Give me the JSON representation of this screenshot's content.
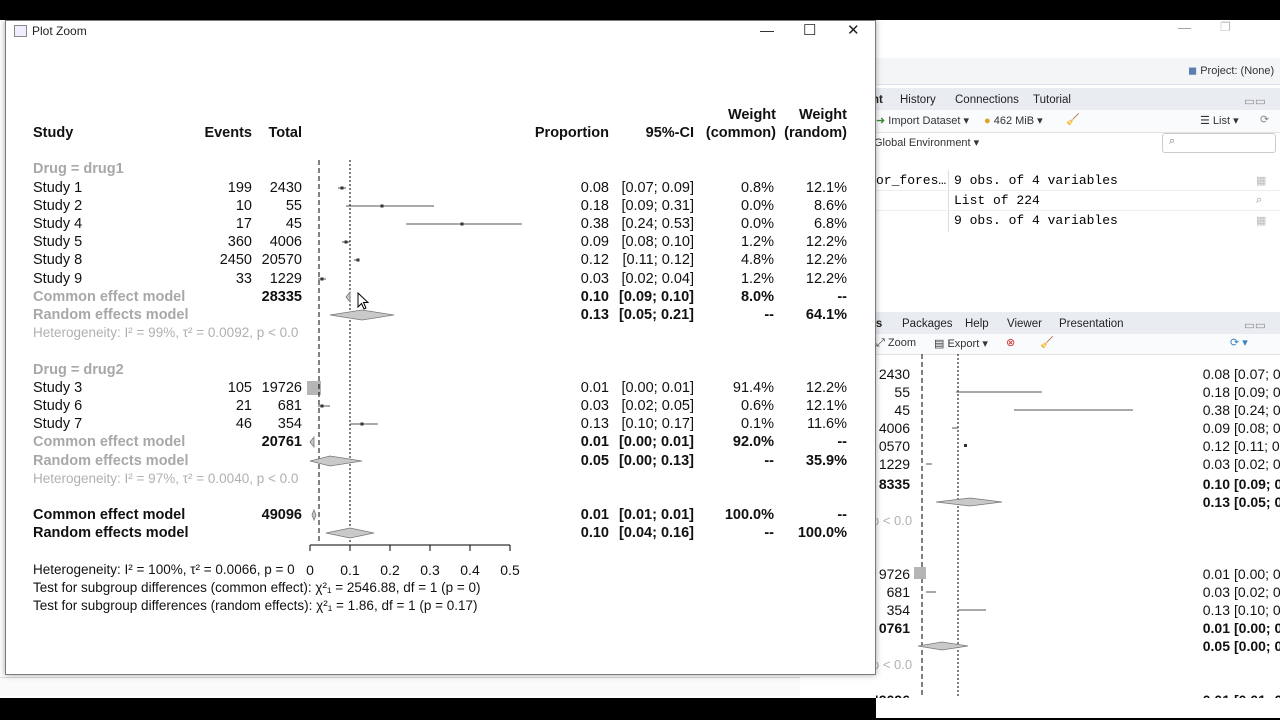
{
  "window": {
    "title": "Plot Zoom",
    "minimize_glyph": "—",
    "maximize_glyph": "☐",
    "close_glyph": "✕"
  },
  "bg": {
    "project": "Project: (None)",
    "env_tabs": [
      "nt",
      "History",
      "Connections",
      "Tutorial"
    ],
    "import_label": "Import Dataset",
    "memory": "462 MiB",
    "list_label": "List",
    "global_env": "Global Environment",
    "env_rows": [
      {
        "name": "or_fores…",
        "value": "9 obs. of 4 variables"
      },
      {
        "name": "",
        "value": "List of  224"
      },
      {
        "name": "",
        "value": "9 obs. of 4 variables"
      }
    ],
    "plot_tabs": [
      "ts",
      "Packages",
      "Help",
      "Viewer",
      "Presentation"
    ],
    "zoom_label": "Zoom",
    "export_label": "Export",
    "mini_rows": [
      {
        "n": "2430",
        "p": "0.08",
        "ci": "[0.07; 0."
      },
      {
        "n": "55",
        "p": "0.18",
        "ci": "[0.09; 0."
      },
      {
        "n": "45",
        "p": "0.38",
        "ci": "[0.24; 0."
      },
      {
        "n": "4006",
        "p": "0.09",
        "ci": "[0.08; 0."
      },
      {
        "n": "0570",
        "p": "0.12",
        "ci": "[0.11; 0."
      },
      {
        "n": "1229",
        "p": "0.03",
        "ci": "[0.02; 0."
      },
      {
        "n": "8335",
        "p": "0.10",
        "ci": "[0.09; 0."
      },
      {
        "n": "",
        "p": "0.13",
        "ci": "[0.05; 0."
      },
      {
        "n": "9726",
        "p": "0.01",
        "ci": "[0.00; 0."
      },
      {
        "n": "681",
        "p": "0.03",
        "ci": "[0.02; 0."
      },
      {
        "n": "354",
        "p": "0.13",
        "ci": "[0.10; 0."
      },
      {
        "n": "0761",
        "p": "0.01",
        "ci": "[0.00; 0."
      },
      {
        "n": "",
        "p": "0.05",
        "ci": "[0.00; 0."
      },
      {
        "n": "49096",
        "p": "0.01",
        "ci": "[0.01; 0."
      }
    ],
    "mini_pval": "p < 0.0"
  },
  "plot": {
    "headers": {
      "study": "Study",
      "events": "Events",
      "total": "Total",
      "proportion": "Proportion",
      "ci": "95%-CI",
      "weight_common_1": "Weight",
      "weight_common_2": "(common)",
      "weight_random_1": "Weight",
      "weight_random_2": "(random)"
    },
    "group1": {
      "label": "Drug = drug1",
      "common_label": "Common effect model",
      "common_total": "28335",
      "common_prop": "0.10",
      "common_ci": "[0.09; 0.10]",
      "common_wc": "8.0%",
      "common_wr": "--",
      "random_label": "Random effects model",
      "random_prop": "0.13",
      "random_ci": "[0.05; 0.21]",
      "random_wc": "--",
      "random_wr": "64.1%",
      "het": "Heterogeneity: I² = 99%, τ² = 0.0092, p < 0.0"
    },
    "group2": {
      "label": "Drug = drug2",
      "common_label": "Common effect model",
      "common_total": "20761",
      "common_prop": "0.01",
      "common_ci": "[0.00; 0.01]",
      "common_wc": "92.0%",
      "common_wr": "--",
      "random_label": "Random effects model",
      "random_prop": "0.05",
      "random_ci": "[0.00; 0.13]",
      "random_wc": "--",
      "random_wr": "35.9%",
      "het": "Heterogeneity: I² = 97%, τ² = 0.0040, p < 0.0"
    },
    "overall": {
      "common_label": "Common effect model",
      "common_total": "49096",
      "common_prop": "0.01",
      "common_ci": "[0.01; 0.01]",
      "common_wc": "100.0%",
      "common_wr": "--",
      "random_label": "Random effects model",
      "random_prop": "0.10",
      "random_ci": "[0.04; 0.16]",
      "random_wc": "--",
      "random_wr": "100.0%"
    },
    "footer": {
      "het": "Heterogeneity: I² = 100%, τ² = 0.0066, p = 0",
      "test_common": "Test for subgroup differences (common effect): χ²₁ = 2546.88, df = 1 (p = 0)",
      "test_random": "Test for subgroup differences (random effects): χ²₁ = 1.86, df = 1 (p = 0.17)"
    },
    "axis_ticks": [
      "0",
      "0.1",
      "0.2",
      "0.3",
      "0.4",
      "0.5"
    ]
  },
  "chart_data": {
    "type": "forest",
    "xlim": [
      0,
      0.5
    ],
    "common_overall": 0.01,
    "random_overall": 0.1,
    "studies": [
      {
        "group": "drug1",
        "study": "Study 1",
        "events": "199",
        "total": "2430",
        "prop": 0.08,
        "lo": 0.07,
        "hi": 0.09,
        "prop_txt": "0.08",
        "ci_txt": "[0.07; 0.09]",
        "wc": "0.8%",
        "wr": "12.1%"
      },
      {
        "group": "drug1",
        "study": "Study 2",
        "events": "10",
        "total": "55",
        "prop": 0.18,
        "lo": 0.09,
        "hi": 0.31,
        "prop_txt": "0.18",
        "ci_txt": "[0.09; 0.31]",
        "wc": "0.0%",
        "wr": "8.6%"
      },
      {
        "group": "drug1",
        "study": "Study 4",
        "events": "17",
        "total": "45",
        "prop": 0.38,
        "lo": 0.24,
        "hi": 0.53,
        "prop_txt": "0.38",
        "ci_txt": "[0.24; 0.53]",
        "wc": "0.0%",
        "wr": "6.8%"
      },
      {
        "group": "drug1",
        "study": "Study 5",
        "events": "360",
        "total": "4006",
        "prop": 0.09,
        "lo": 0.08,
        "hi": 0.1,
        "prop_txt": "0.09",
        "ci_txt": "[0.08; 0.10]",
        "wc": "1.2%",
        "wr": "12.2%"
      },
      {
        "group": "drug1",
        "study": "Study 8",
        "events": "2450",
        "total": "20570",
        "prop": 0.12,
        "lo": 0.11,
        "hi": 0.12,
        "prop_txt": "0.12",
        "ci_txt": "[0.11; 0.12]",
        "wc": "4.8%",
        "wr": "12.2%"
      },
      {
        "group": "drug1",
        "study": "Study 9",
        "events": "33",
        "total": "1229",
        "prop": 0.03,
        "lo": 0.02,
        "hi": 0.04,
        "prop_txt": "0.03",
        "ci_txt": "[0.02; 0.04]",
        "wc": "1.2%",
        "wr": "12.2%"
      },
      {
        "group": "drug2",
        "study": "Study 3",
        "events": "105",
        "total": "19726",
        "prop": 0.01,
        "lo": 0.0,
        "hi": 0.01,
        "prop_txt": "0.01",
        "ci_txt": "[0.00; 0.01]",
        "wc": "91.4%",
        "wr": "12.2%"
      },
      {
        "group": "drug2",
        "study": "Study 6",
        "events": "21",
        "total": "681",
        "prop": 0.03,
        "lo": 0.02,
        "hi": 0.05,
        "prop_txt": "0.03",
        "ci_txt": "[0.02; 0.05]",
        "wc": "0.6%",
        "wr": "12.1%"
      },
      {
        "group": "drug2",
        "study": "Study 7",
        "events": "46",
        "total": "354",
        "prop": 0.13,
        "lo": 0.1,
        "hi": 0.17,
        "prop_txt": "0.13",
        "ci_txt": "[0.10; 0.17]",
        "wc": "0.1%",
        "wr": "11.6%"
      }
    ],
    "diamonds": [
      {
        "label": "drug1 common",
        "est": 0.1,
        "lo": 0.09,
        "hi": 0.1
      },
      {
        "label": "drug1 random",
        "est": 0.13,
        "lo": 0.05,
        "hi": 0.21
      },
      {
        "label": "drug2 common",
        "est": 0.01,
        "lo": 0.0,
        "hi": 0.01
      },
      {
        "label": "drug2 random",
        "est": 0.05,
        "lo": 0.0,
        "hi": 0.13
      },
      {
        "label": "overall common",
        "est": 0.01,
        "lo": 0.01,
        "hi": 0.01
      },
      {
        "label": "overall random",
        "est": 0.1,
        "lo": 0.04,
        "hi": 0.16
      }
    ]
  }
}
